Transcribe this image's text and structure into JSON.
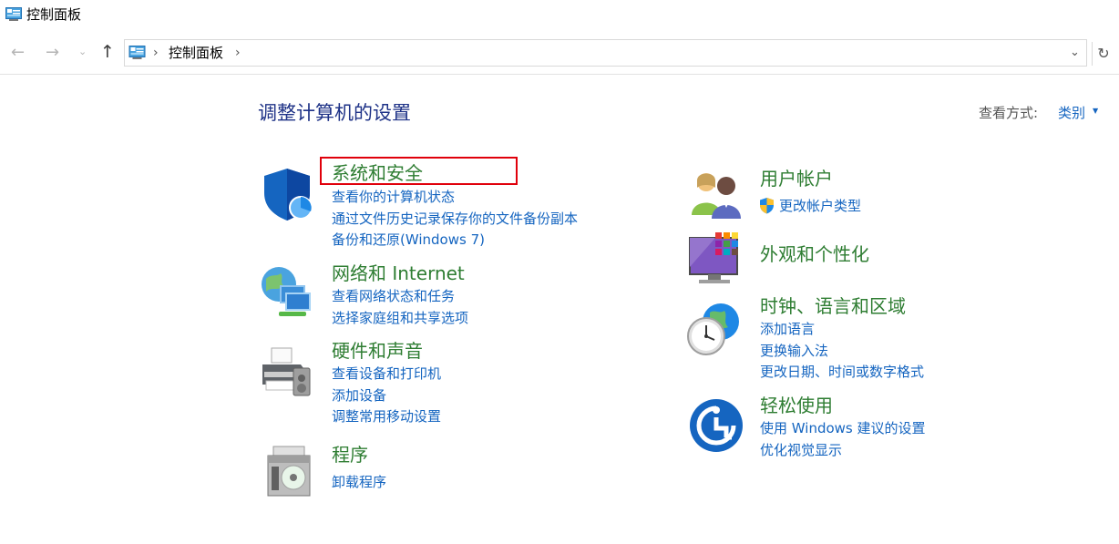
{
  "window": {
    "title": "控制面板",
    "icon": "control-panel-icon"
  },
  "nav": {
    "back": "←",
    "forward": "→",
    "recent": "⌄",
    "up": "↑",
    "address": {
      "icon": "control-panel-icon",
      "separator": "›",
      "crumb": "控制面板"
    },
    "dropdown": "⌄",
    "refresh": "↻"
  },
  "page": {
    "title": "调整计算机的设置",
    "view_by_label": "查看方式:",
    "view_by_value": "类别"
  },
  "categories_left": [
    {
      "title": "系统和安全",
      "icon": "shield-icon",
      "links": [
        "查看你的计算机状态",
        "通过文件历史记录保存你的文件备份副本",
        "备份和还原(Windows 7)"
      ]
    },
    {
      "title": "网络和 Internet",
      "icon": "network-icon",
      "links": [
        "查看网络状态和任务",
        "选择家庭组和共享选项"
      ]
    },
    {
      "title": "硬件和声音",
      "icon": "printer-icon",
      "links": [
        "查看设备和打印机",
        "添加设备",
        "调整常用移动设置"
      ]
    },
    {
      "title": "程序",
      "icon": "programs-icon",
      "links": [
        "卸载程序"
      ]
    }
  ],
  "categories_right": [
    {
      "title": "用户帐户",
      "icon": "users-icon",
      "links": [
        "更改帐户类型"
      ],
      "link_icons": [
        "uac-shield-icon"
      ]
    },
    {
      "title": "外观和个性化",
      "icon": "monitor-icon",
      "links": []
    },
    {
      "title": "时钟、语言和区域",
      "icon": "clock-globe-icon",
      "links": [
        "添加语言",
        "更换输入法",
        "更改日期、时间或数字格式"
      ]
    },
    {
      "title": "轻松使用",
      "icon": "ease-of-access-icon",
      "links": [
        "使用 Windows 建议的设置",
        "优化视觉显示"
      ]
    }
  ],
  "colors": {
    "accent_link": "#1565c0",
    "category_title": "#2e7d32",
    "heading": "#1e3287",
    "highlight": "#e0000b"
  }
}
